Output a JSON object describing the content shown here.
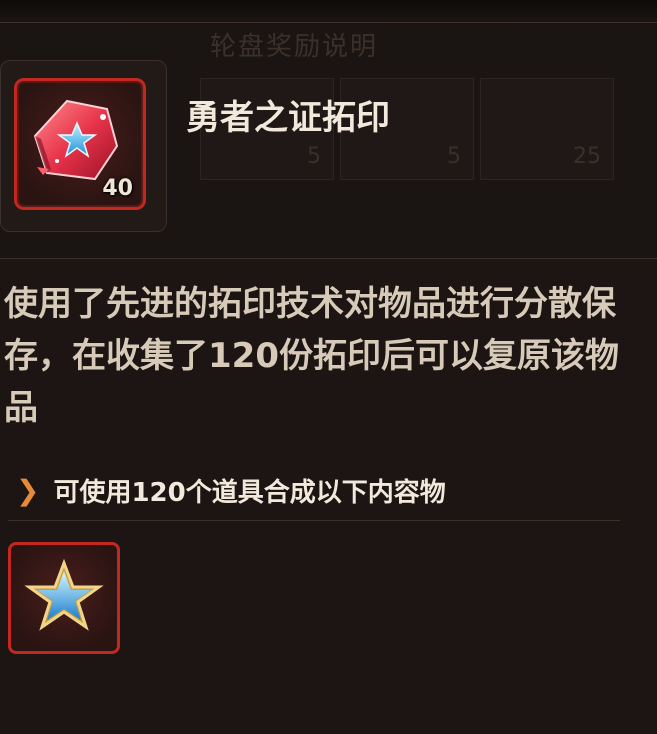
{
  "background": {
    "title": "轮盘奖励说明",
    "slot_counts": [
      "5",
      "5",
      "25"
    ]
  },
  "item": {
    "name": "勇者之证拓印",
    "count": "40",
    "icon": "red-gem-star-icon"
  },
  "description": "使用了先进的拓印技术对物品进行分散保存，在收集了120份拓印后可以复原该物品",
  "synthesis": {
    "label": "可使用120个道具合成以下内容物",
    "result_icon": "blue-star-icon"
  },
  "colors": {
    "frame_red": "#c2281f",
    "accent_orange": "#e68a3a"
  }
}
